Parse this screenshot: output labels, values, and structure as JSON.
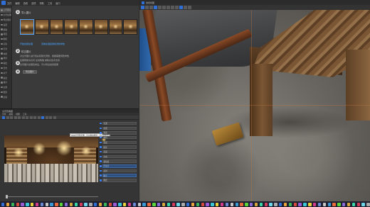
{
  "left_app": {
    "menu": [
      "文件",
      "编辑",
      "查看",
      "选项",
      "帮助",
      "工具",
      "窗口"
    ],
    "sidebar": [
      "上传图片",
      "全景处理",
      "导出图片",
      "设置",
      "帮助",
      "项目",
      "相机",
      "渲染",
      "灯光",
      "材质",
      "场景",
      "输出",
      "日志",
      "关于",
      "退出",
      "语言",
      "主题",
      "更新",
      "反馈"
    ],
    "steps": [
      {
        "num": "1",
        "title": "导入图片"
      },
      {
        "num": "2",
        "title": "校正图片",
        "desc": "对全景图片进行色彩和曝光调整，根据需要调整参数"
      },
      {
        "num": "3",
        "desc": "全景图片处理完成后，可以导出最终结果"
      },
      {
        "num": "4",
        "desc": ""
      }
    ],
    "links": [
      "开始批量处理",
      "查看处理结果和调整参数"
    ],
    "desc_extra": "如需帮助请访问 在线教程 或联系技术支持",
    "step4_button": "导出图片"
  },
  "viewer": {
    "title": "全景查看器",
    "menu": [
      "文件",
      "编辑",
      "视图",
      "工具"
    ],
    "tooltip": "HDR全景预览图，可以拖动旋转，点击选择光源位置",
    "props": [
      "光源",
      "位置",
      "强度",
      "颜色",
      "温度",
      "阴影",
      "高度",
      "方向",
      "柔和度",
      "环境光",
      "反射",
      "曝光",
      "确定"
    ]
  },
  "viewport": {
    "title": "透视视图"
  },
  "taskbar": {
    "icon_colors": [
      "#2f6fd6",
      "#e8a33a",
      "#3ab35a",
      "#d94a3a",
      "#9a5ad6",
      "#3ac6d6",
      "#e8d23a",
      "#d63a8a",
      "#6a8ad6",
      "#c6c6c6",
      "#3a9ad6",
      "#e86a3a",
      "#5ad63a",
      "#8a6ad6",
      "#d6a63a",
      "#3ad6a6",
      "#d63a5a",
      "#6ad6e8",
      "#aaaaaa",
      "#2f6fd6",
      "#e8a33a",
      "#3ab35a",
      "#d94a3a",
      "#9a5ad6",
      "#3ac6d6",
      "#e8d23a",
      "#d63a8a",
      "#6a8ad6",
      "#c6c6c6",
      "#3a9ad6",
      "#e86a3a",
      "#5ad63a",
      "#8a6ad6",
      "#d6a63a",
      "#3ad6a6",
      "#d63a5a",
      "#6ad6e8",
      "#aaaaaa",
      "#2f6fd6",
      "#e8a33a",
      "#3ab35a",
      "#d94a3a",
      "#9a5ad6",
      "#3ac6d6",
      "#e8d23a",
      "#d63a8a",
      "#6a8ad6",
      "#c6c6c6",
      "#3a9ad6",
      "#e86a3a",
      "#5ad63a",
      "#8a6ad6",
      "#d6a63a",
      "#3ad6a6",
      "#d63a5a",
      "#6ad6e8",
      "#aaaaaa",
      "#2f6fd6",
      "#e8a33a",
      "#3ab35a",
      "#d94a3a",
      "#9a5ad6",
      "#3ac6d6",
      "#e8d23a",
      "#d63a8a",
      "#6a8ad6",
      "#c6c6c6",
      "#3a9ad6",
      "#e86a3a",
      "#5ad63a",
      "#8a6ad6",
      "#d6a63a",
      "#3ad6a6",
      "#d63a5a",
      "#6ad6e8",
      "#aaaaaa"
    ]
  }
}
